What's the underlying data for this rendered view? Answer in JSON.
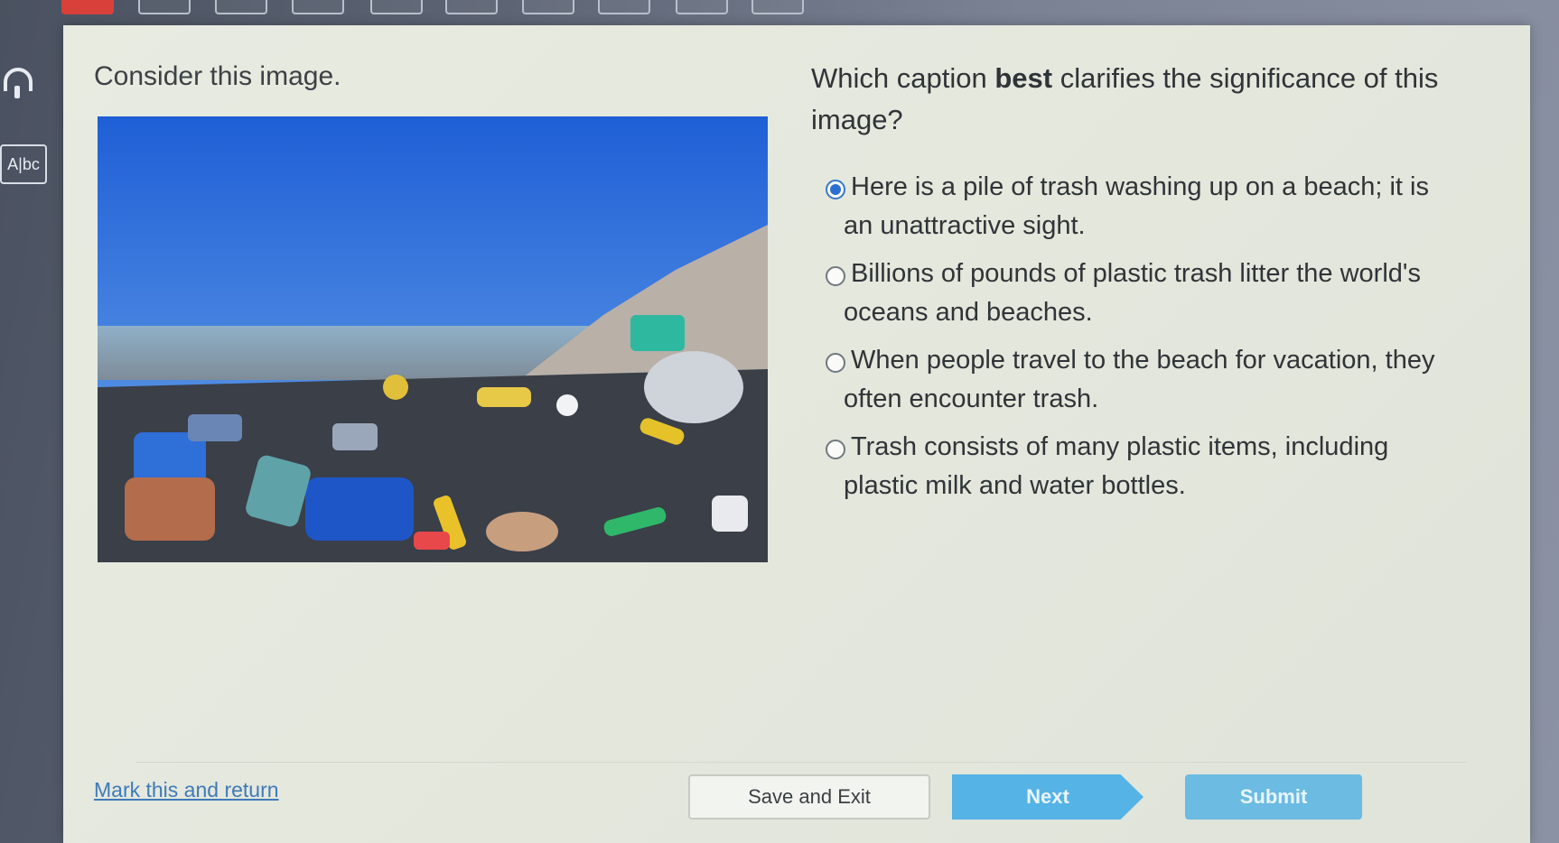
{
  "progress": {
    "total_cells": 10,
    "current_index": 0
  },
  "toolbar": {
    "headphones_icon": "headphones-icon",
    "dictionary_icon": "dictionary-icon",
    "dictionary_label": "A|bc"
  },
  "prompt": {
    "left": "Consider this image."
  },
  "question": {
    "prefix": "Which caption ",
    "emphasis": "best",
    "suffix": " clarifies the significance of this image?"
  },
  "image": {
    "description_icon": "photo-beach-plastic-trash"
  },
  "options": [
    {
      "first": "Here is a pile of trash washing up on a beach; it is",
      "rest": "an unattractive sight.",
      "selected": true
    },
    {
      "first": "Billions of pounds of plastic trash litter the world's",
      "rest": "oceans and beaches.",
      "selected": false
    },
    {
      "first": "When people travel to the beach for vacation, they",
      "rest": "often encounter trash.",
      "selected": false
    },
    {
      "first": "Trash consists of many plastic items, including",
      "rest": "plastic milk and water bottles.",
      "selected": false
    }
  ],
  "footer": {
    "mark_label": "Mark this and return",
    "save_label": "Save and Exit",
    "next_label": "Next",
    "submit_label": "Submit"
  }
}
